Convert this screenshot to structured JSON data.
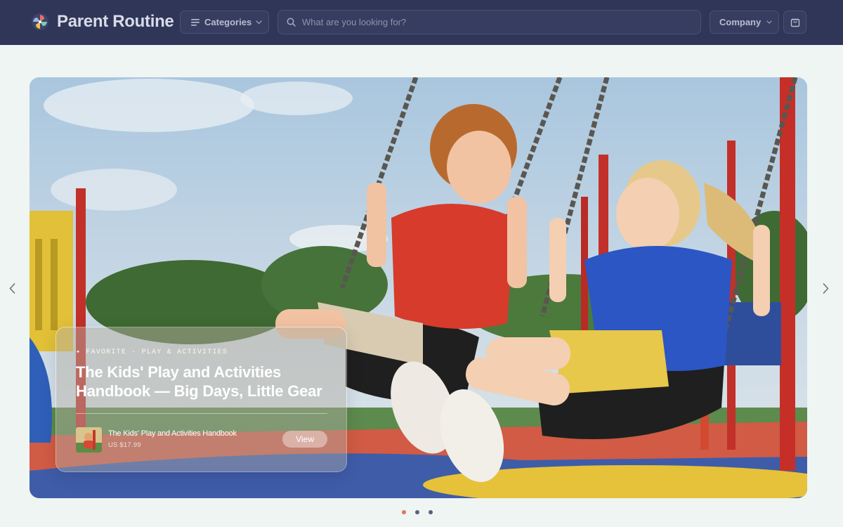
{
  "header": {
    "brand": "Parent Routine",
    "categories_label": "Categories",
    "search_placeholder": "What are you looking for?",
    "company_label": "Company",
    "icons": [
      "logo-pinwheel-icon",
      "menu-lines-icon",
      "chevron-down-icon",
      "search-icon",
      "shopping-bag-icon"
    ]
  },
  "hero": {
    "eyebrow": "✦ FAVORITE · PLAY & ACTIVITIES",
    "title": "The Kids' Play and Activities Handbook — Big Days, Little Gear",
    "product": {
      "title": "The Kids' Play and Activities Handbook",
      "price": "US $17.99"
    },
    "view_label": "View"
  },
  "carousel": {
    "slide_count": 3,
    "active_index": 0
  },
  "colors": {
    "header_bg": "#2f3658",
    "page_bg": "#eef5f3",
    "active_dot": "#e9715e",
    "inactive_dot": "#5b6175"
  }
}
